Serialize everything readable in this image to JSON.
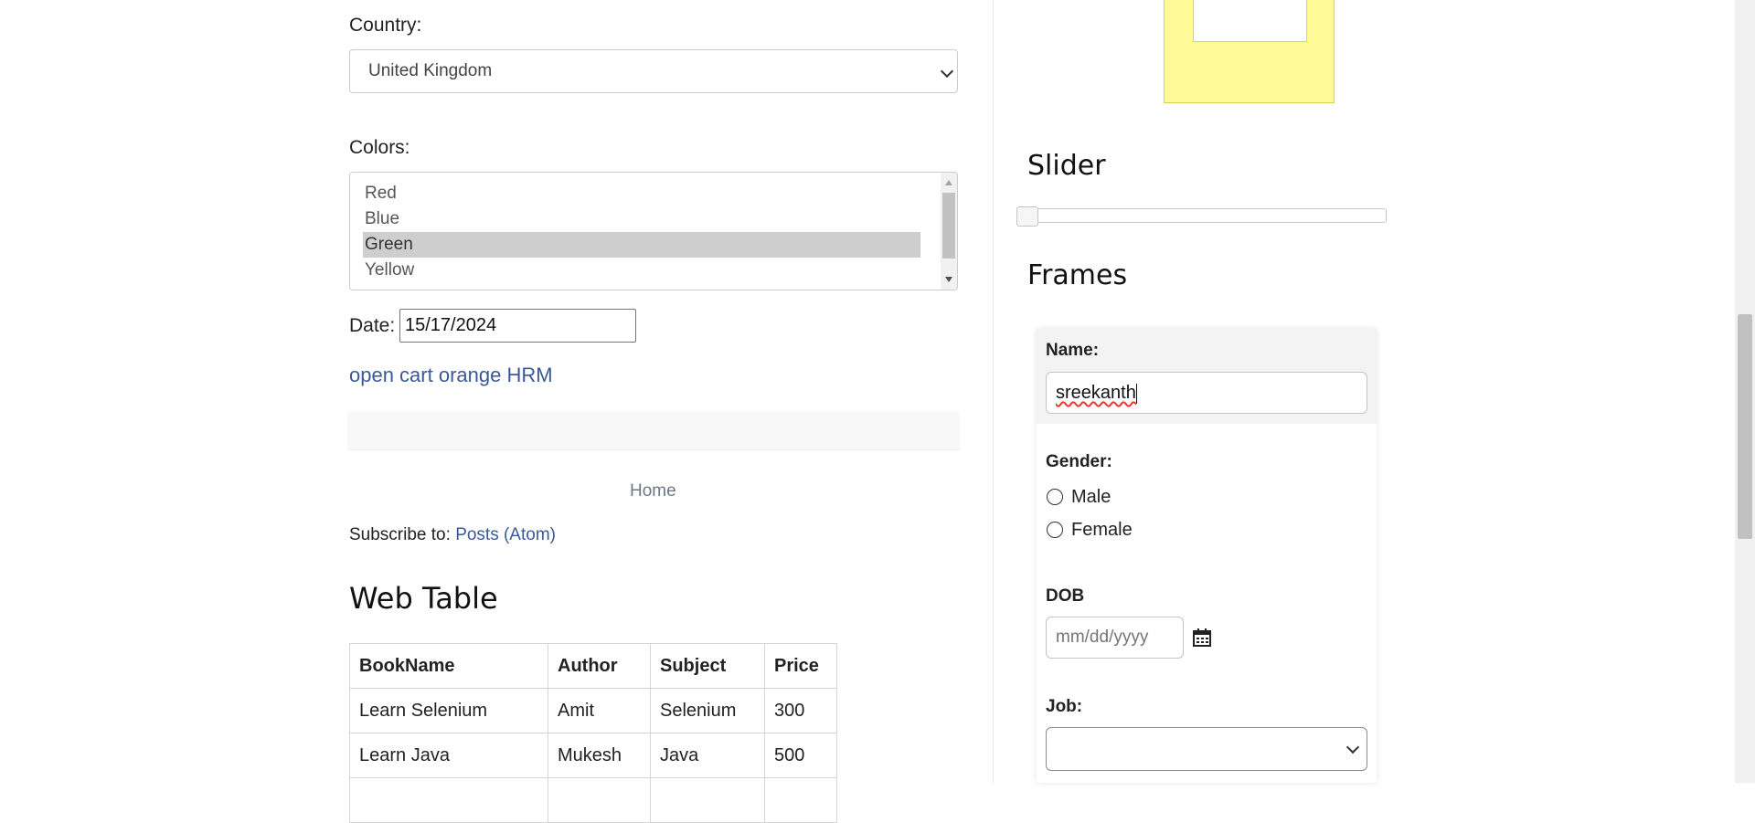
{
  "form": {
    "country_label": "Country:",
    "country_value": "United Kingdom",
    "colors_label": "Colors:",
    "colors_options": [
      "Red",
      "Blue",
      "Green",
      "Yellow"
    ],
    "colors_selected": "Green",
    "date_label": "Date:",
    "date_value": "15/17/2024",
    "link_text": "open cart orange HRM"
  },
  "blog": {
    "home_link": "Home",
    "subscribe_prefix": "Subscribe to:",
    "subscribe_link": "Posts (Atom)"
  },
  "web_table": {
    "title": "Web Table",
    "headers": [
      "BookName",
      "Author",
      "Subject",
      "Price"
    ],
    "rows": [
      [
        "Learn Selenium",
        "Amit",
        "Selenium",
        "300"
      ],
      [
        "Learn Java",
        "Mukesh",
        "Java",
        "500"
      ]
    ]
  },
  "slider": {
    "title": "Slider",
    "value_fraction": 0.0
  },
  "frames": {
    "title": "Frames",
    "name_label": "Name:",
    "name_value": "sreekanth",
    "gender_label": "Gender:",
    "gender_options": [
      "Male",
      "Female"
    ],
    "dob_label": "DOB",
    "dob_placeholder": "mm/dd/yyyy",
    "job_label": "Job:",
    "job_value": ""
  },
  "colors": {
    "droppable_fill": "#fffa96",
    "link": "#3b5998",
    "selected_option": "#cecece"
  }
}
